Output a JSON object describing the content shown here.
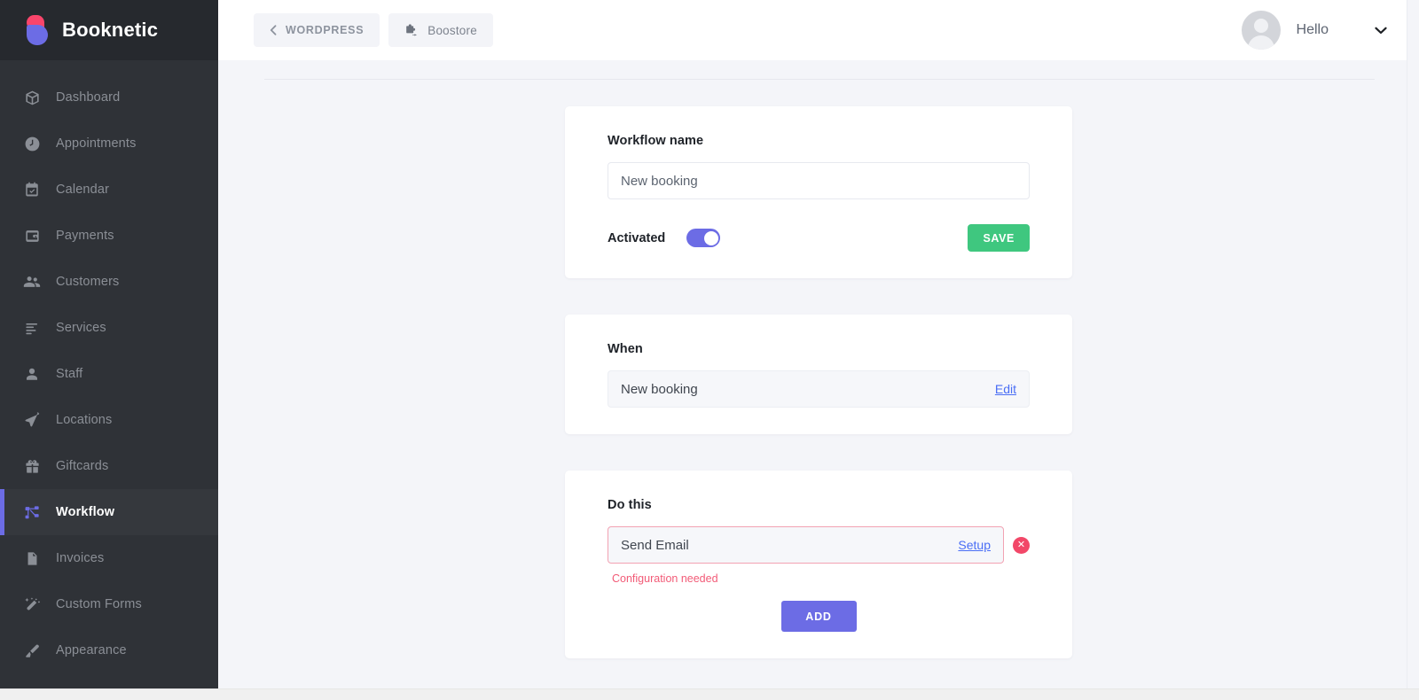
{
  "brand": {
    "name": "Booknetic",
    "logo_icon": "booknetic-logo-icon",
    "accent_purple": "#6c6ce5",
    "accent_pink": "#f9456b"
  },
  "sidebar": {
    "items": [
      {
        "label": "Dashboard",
        "icon": "box-icon",
        "active": false
      },
      {
        "label": "Appointments",
        "icon": "clock-icon",
        "active": false
      },
      {
        "label": "Calendar",
        "icon": "calendar-icon",
        "active": false
      },
      {
        "label": "Payments",
        "icon": "wallet-icon",
        "active": false
      },
      {
        "label": "Customers",
        "icon": "users-icon",
        "active": false
      },
      {
        "label": "Services",
        "icon": "list-icon",
        "active": false
      },
      {
        "label": "Staff",
        "icon": "user-icon",
        "active": false
      },
      {
        "label": "Locations",
        "icon": "send-icon",
        "active": false
      },
      {
        "label": "Giftcards",
        "icon": "gift-icon",
        "active": false
      },
      {
        "label": "Workflow",
        "icon": "sitemap-icon",
        "active": true
      },
      {
        "label": "Invoices",
        "icon": "document-icon",
        "active": false
      },
      {
        "label": "Custom Forms",
        "icon": "magicwand-icon",
        "active": false
      },
      {
        "label": "Appearance",
        "icon": "brush-icon",
        "active": false
      }
    ]
  },
  "topbar": {
    "wordpress_button": {
      "label": "WORDPRESS",
      "icon": "chevron-left-icon"
    },
    "boostore_button": {
      "label": "Boostore",
      "icon": "puzzle-plugin-icon"
    },
    "user": {
      "greeting": "Hello",
      "avatar_icon": "avatar-placeholder-icon",
      "caret_icon": "chevron-down-icon"
    }
  },
  "workflow_card": {
    "title": "Workflow name",
    "name_value": "New booking",
    "name_placeholder": "New booking",
    "activated_label": "Activated",
    "activated_on": true,
    "save_label": "SAVE",
    "save_color": "#3fc77f"
  },
  "when_card": {
    "title": "When",
    "trigger_label": "New booking",
    "edit_label": "Edit"
  },
  "do_this_card": {
    "title": "Do this",
    "action_label": "Send Email",
    "setup_label": "Setup",
    "delete_icon": "close-circle-icon",
    "error_message": "Configuration needed",
    "error_color": "#f25b77",
    "add_label": "ADD",
    "add_color": "#6c6ce5"
  }
}
